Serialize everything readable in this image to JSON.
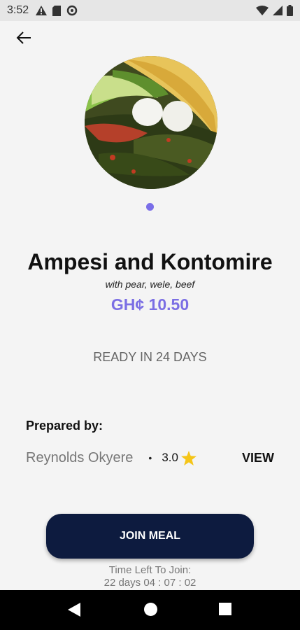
{
  "status_bar": {
    "time": "3:52"
  },
  "meal": {
    "title": "Ampesi and Kontomire",
    "subtitle": "with pear, wele, beef",
    "price": "GH¢ 10.50",
    "ready_text": "READY IN 24 DAYS"
  },
  "prepared_by": {
    "label": "Prepared by:",
    "chef_name": "Reynolds Okyere",
    "separator": "•",
    "rating": "3.0",
    "view_label": "VIEW"
  },
  "join": {
    "button_label": "JOIN MEAL",
    "time_left_label": "Time Left To Join:",
    "time_left_value": "22 days 04 : 07 : 02"
  },
  "colors": {
    "accent": "#7b6fe4",
    "button": "#0d1b3f",
    "star": "#f5c518"
  }
}
